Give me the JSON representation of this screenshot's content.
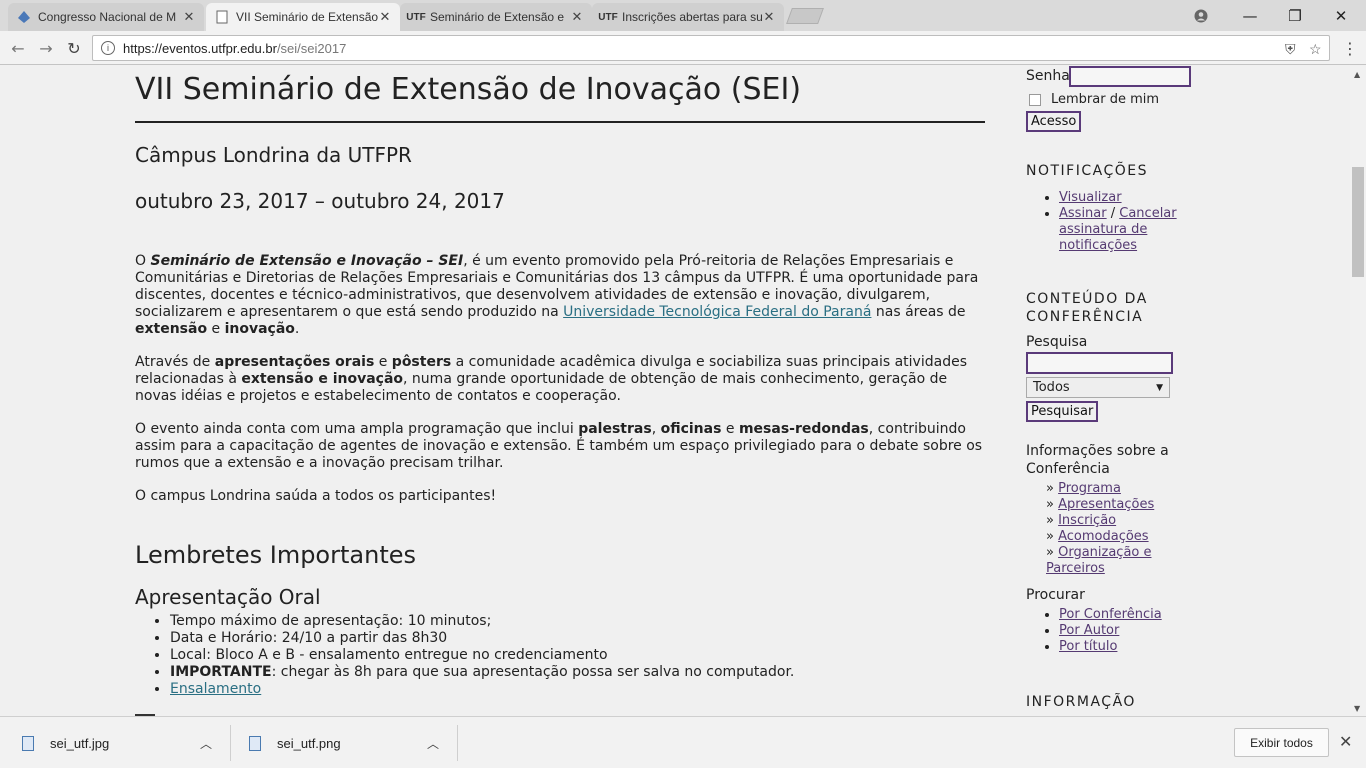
{
  "browser": {
    "tabs": [
      {
        "title": "Congresso Nacional de M",
        "favicon": "drop-icon"
      },
      {
        "title": "VII Seminário de Extensão",
        "favicon": "page-icon"
      },
      {
        "title": "Seminário de Extensão e",
        "favicon": "UTF"
      },
      {
        "title": "Inscrições abertas para su",
        "favicon": "UTF"
      }
    ],
    "url_host": "https://eventos.utfpr.edu.br",
    "url_path": "/sei/sei2017"
  },
  "main": {
    "title": "VII Seminário de Extensão de Inovação (SEI)",
    "campus": "Câmpus Londrina da UTFPR",
    "dates": "outubro 23, 2017 – outubro 24, 2017",
    "p1": {
      "o": "O ",
      "sei": "Seminário de Extensão e Inovação – SEI",
      "rest": ", é um evento promovido pela Pró-reitoria de Relações Empresariais e Comunitárias e Diretorias de Relações Empresariais e Comunitárias dos 13 câmpus da UTFPR. É uma oportunidade para discentes, docentes e técnico-administrativos, que desenvolvem atividades de extensão e inovação, divulgarem, socializarem e apresentarem o que está sendo produzido na ",
      "link": "Universidade Tecnológica Federal do Paraná",
      "after_link": " nas áreas de ",
      "ext": "extensão",
      "e": " e ",
      "inov": "inovação",
      "end": "."
    },
    "p2": {
      "a": "Através de ",
      "b1": "apresentações orais",
      "c": " e ",
      "b2": "pôsters",
      "d": " a comunidade acadêmica divulga e sociabiliza suas principais atividades relacionadas à ",
      "b3": "extensão e inovação",
      "e": ", numa grande oportunidade de obtenção de mais conhecimento, geração de novas idéias e projetos e estabelecimento de contatos e cooperação."
    },
    "p3": {
      "a": "O evento ainda conta com uma ampla programação que inclui ",
      "b1": "palestras",
      "c": ", ",
      "b2": "oficinas",
      "d": " e ",
      "b3": "mesas-redondas",
      "e": ", contribuindo assim para a capacitação de agentes de inovação e extensão. É também um espaço privilegiado para o debate sobre os rumos que a extensão e a inovação precisam trilhar."
    },
    "p4": "O campus Londrina saúda a todos os participantes!",
    "reminders_title": "Lembretes Importantes",
    "oral_title": "Apresentação Oral",
    "oral_items": [
      "Tempo máximo de apresentação: 10 minutos;",
      "Data e Horário: 24/10 a partir das 8h30",
      "Local: Bloco A e B - ensalamento entregue no credenciamento"
    ],
    "important_label": "IMPORTANTE",
    "important_text": ": chegar às 8h para que sua apresentação possa ser salva no computador.",
    "ensalamento_link": "Ensalamento"
  },
  "sidebar": {
    "password_label": "Senha",
    "remember_label": "Lembrar de mim",
    "login_button": "Acesso",
    "notifications_title": "NOTIFICAÇÕES",
    "notif_view": "Visualizar",
    "notif_subscribe": "Assinar",
    "notif_sep": " / ",
    "notif_cancel": "Cancelar assinatura de notificações",
    "content_title": "CONTEÚDO DA CONFERÊNCIA",
    "search_label": "Pesquisa",
    "search_scope": "Todos",
    "search_button": "Pesquisar",
    "info_title": "Informações sobre a Conferência",
    "info_links": [
      "Programa",
      "Apresentações",
      "Inscrição",
      "Acomodações",
      "Organização e Parceiros"
    ],
    "browse_title": "Procurar",
    "browse_links": [
      "Por Conferência",
      "Por Autor",
      "Por título"
    ],
    "information_title": "INFORMAÇÃO"
  },
  "downloads": {
    "items": [
      "sei_utf.jpg",
      "sei_utf.png"
    ],
    "show_all": "Exibir todos"
  }
}
